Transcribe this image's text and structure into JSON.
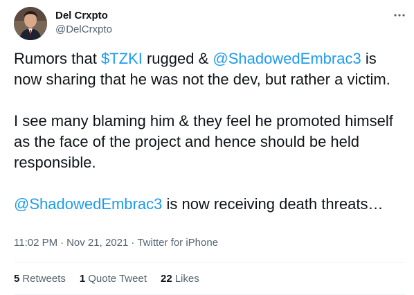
{
  "author": {
    "display_name": "Del Crxpto",
    "handle": "@DelCrxpto",
    "avatar_icon": "profile-photo"
  },
  "more_icon": "more-horizontal-icon",
  "tweet": {
    "p1_a": "Rumors that ",
    "p1_cashtag": "$TZKI",
    "p1_b": " rugged & ",
    "p1_mention": "@ShadowedEmbrac3",
    "p1_c": " is now sharing that he was not the dev, but rather a victim.",
    "p2": "I see many blaming him & they feel he  promoted himself as the face of the project and hence should be held responsible.",
    "p3_mention": "@ShadowedEmbrac3",
    "p3_b": " is now receiving death threats…"
  },
  "meta": {
    "time": "11:02 PM",
    "separator": "·",
    "date": "Nov 21, 2021",
    "source": "Twitter for iPhone"
  },
  "stats": {
    "retweets_count": "5",
    "retweets_label": "Retweets",
    "quotes_count": "1",
    "quotes_label": "Quote Tweet",
    "likes_count": "22",
    "likes_label": "Likes"
  },
  "colors": {
    "link": "#1d9bf0",
    "text": "#0f1419",
    "secondary": "#536471"
  }
}
